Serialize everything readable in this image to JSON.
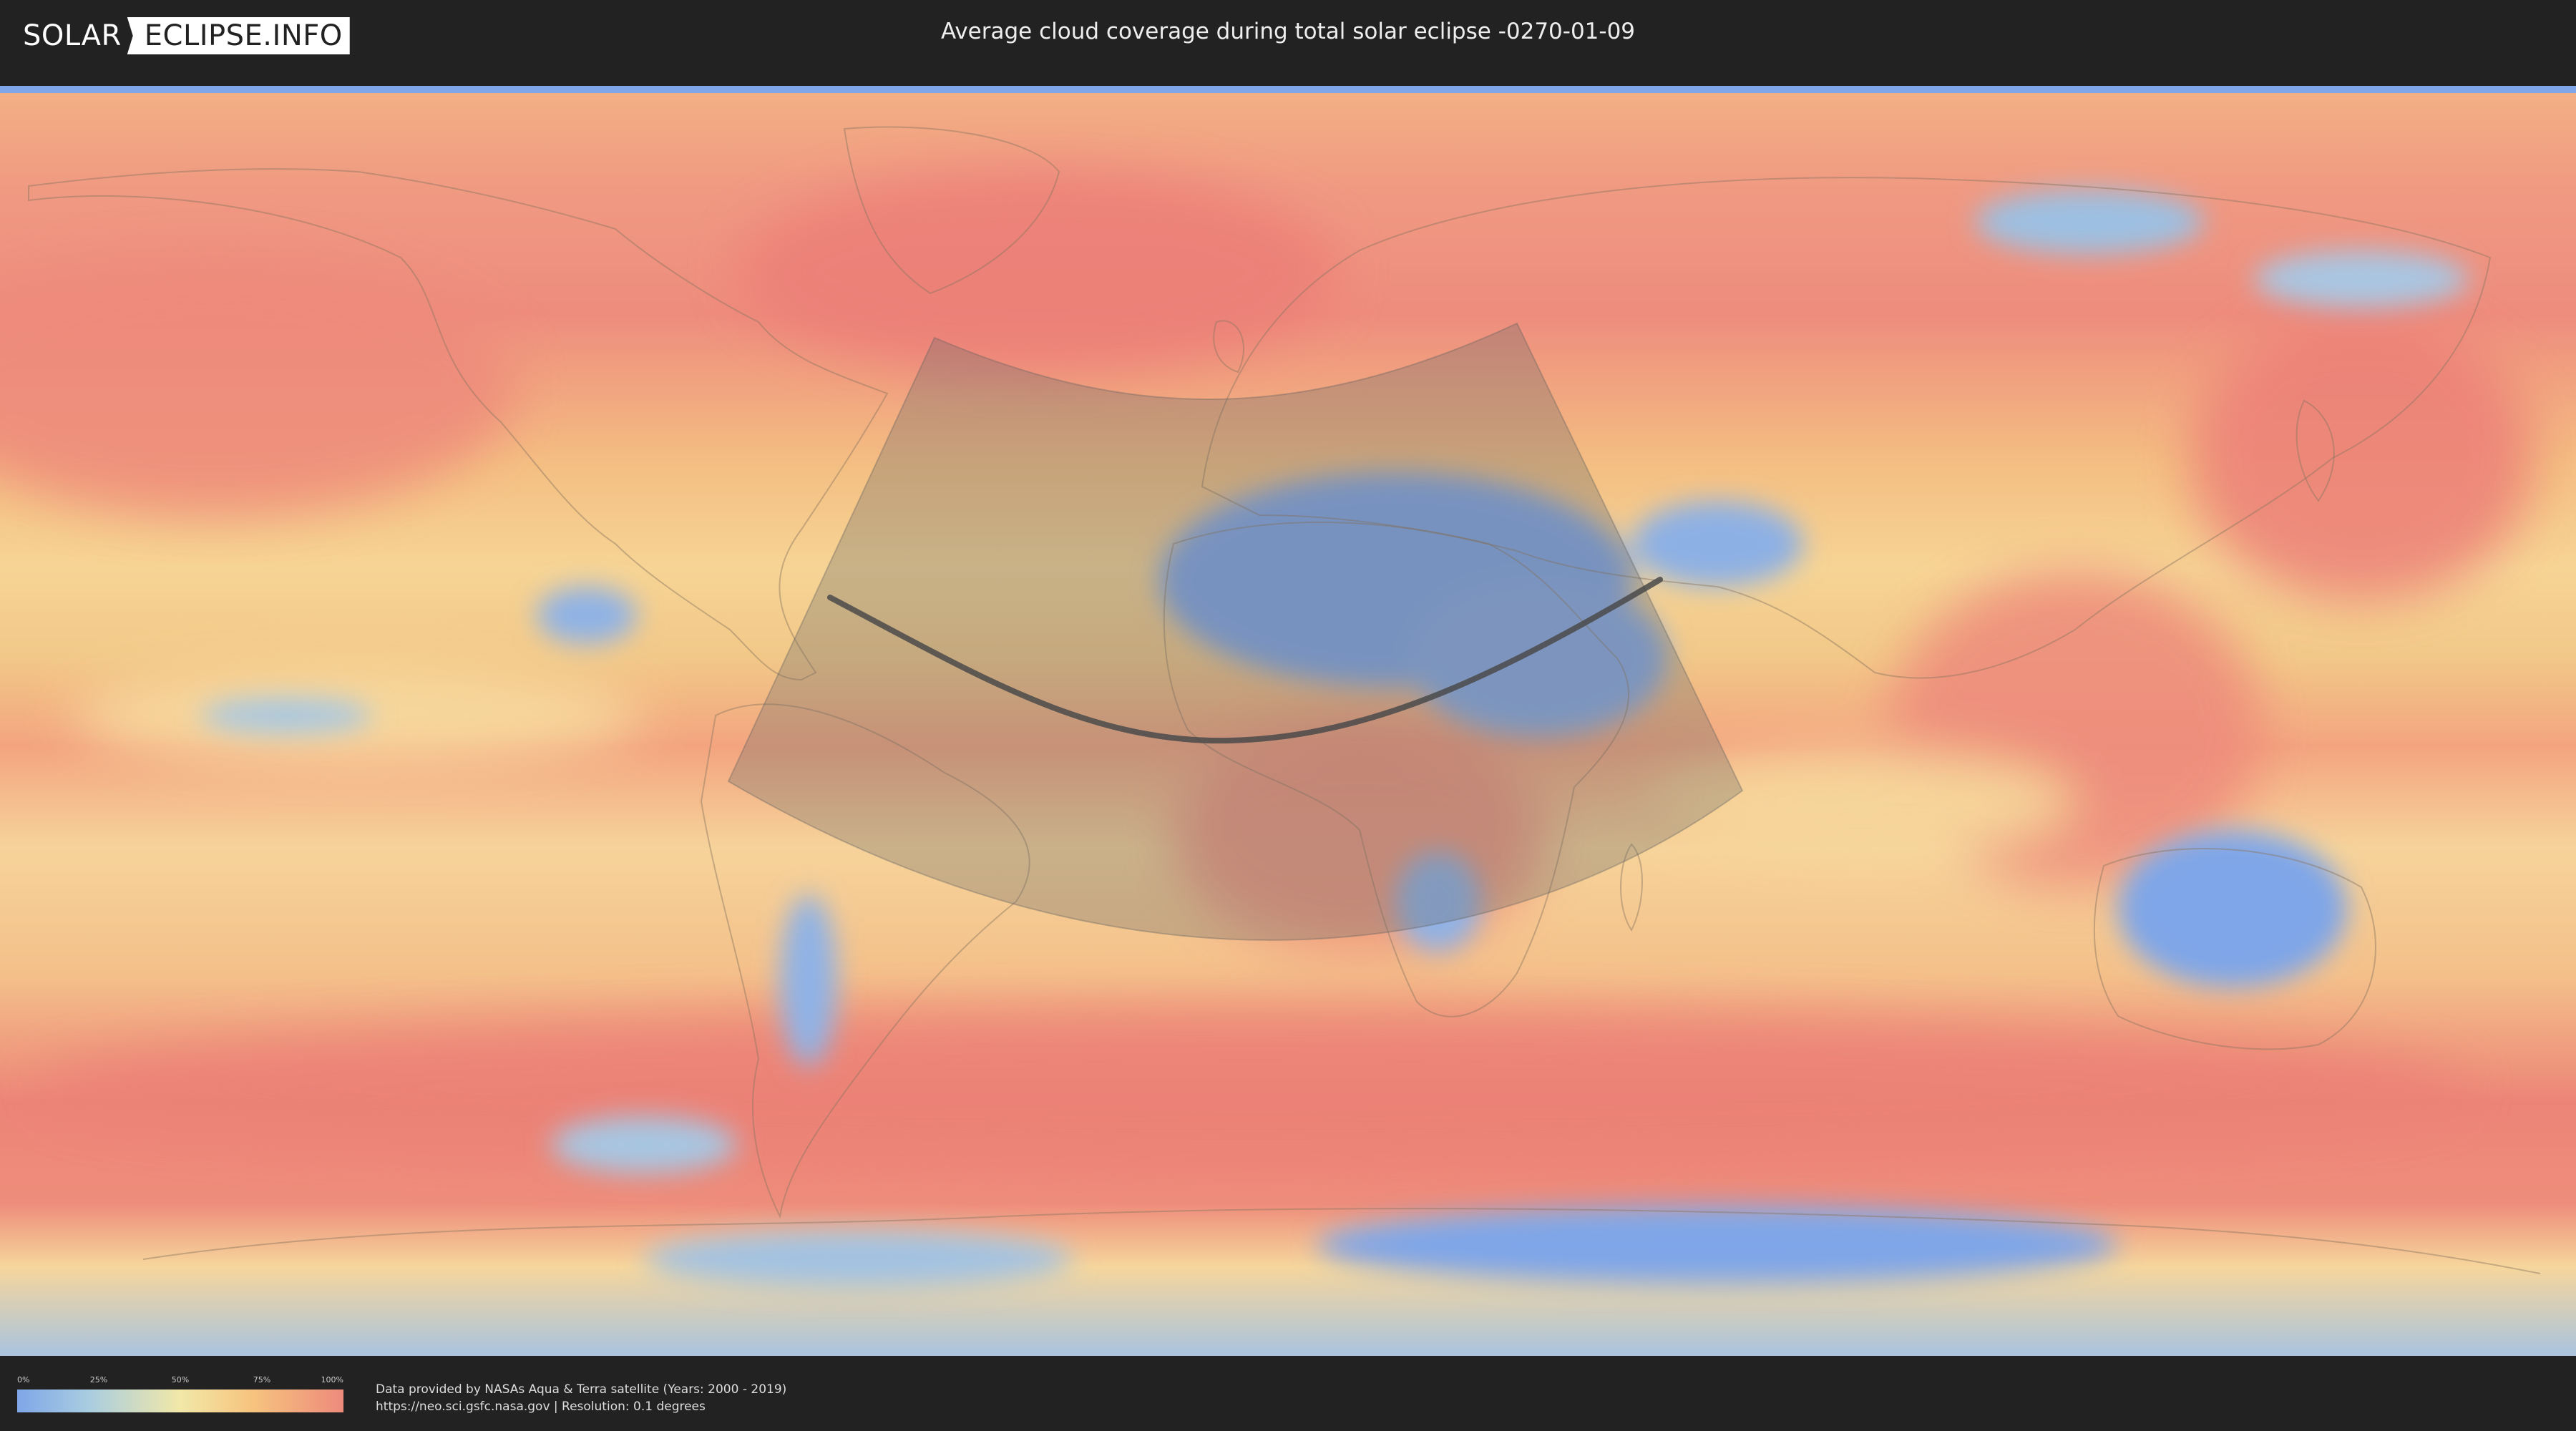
{
  "header": {
    "logo_part_1": "SOLAR",
    "logo_part_2": "ECLIPSE.INFO",
    "title": "Average cloud coverage during total solar eclipse -0270-01-09"
  },
  "legend": {
    "ticks": [
      "0%",
      "25%",
      "50%",
      "75%",
      "100%"
    ]
  },
  "footer": {
    "credit_line_1": "Data provided by NASAs Aqua & Terra satellite (Years: 2000 - 2019)",
    "credit_line_2": "https://neo.sci.gsfc.nasa.gov | Resolution: 0.1 degrees"
  },
  "colors": {
    "background": "#222222",
    "cloud_low": "#7fa6e8",
    "cloud_mid": "#f2e8a8",
    "cloud_high": "#ee8a7c",
    "eclipse_overlay": "#6b6b6b"
  }
}
